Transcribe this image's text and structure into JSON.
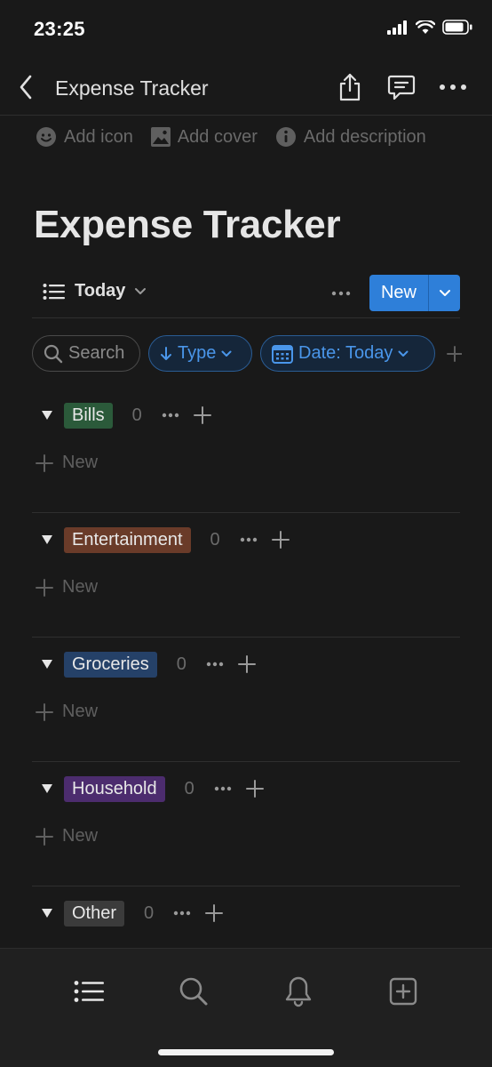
{
  "status_bar": {
    "time": "23:25"
  },
  "nav": {
    "title": "Expense Tracker"
  },
  "meta": {
    "add_icon": "Add icon",
    "add_cover": "Add cover",
    "add_description": "Add description"
  },
  "page": {
    "title": "Expense Tracker"
  },
  "view": {
    "name": "Today",
    "new_label": "New"
  },
  "filters": {
    "search": "Search",
    "type": "Type",
    "date": "Date: Today"
  },
  "groups": [
    {
      "name": "Bills",
      "count": "0",
      "color": "#2b5a3a",
      "new_label": "New"
    },
    {
      "name": "Entertainment",
      "count": "0",
      "color": "#6a3b29",
      "new_label": "New"
    },
    {
      "name": "Groceries",
      "count": "0",
      "color": "#254168",
      "new_label": "New"
    },
    {
      "name": "Household",
      "count": "0",
      "color": "#4c2c6e",
      "new_label": "New"
    },
    {
      "name": "Other",
      "count": "0",
      "color": "#3b3b3b",
      "new_label": "New"
    }
  ],
  "colors": {
    "accent": "#2e7fd9",
    "background": "#191919",
    "filter_blue": "#4a96ea"
  },
  "icons": {
    "tabs": [
      "list-icon",
      "search-icon",
      "bell-icon",
      "add-page-icon"
    ]
  }
}
